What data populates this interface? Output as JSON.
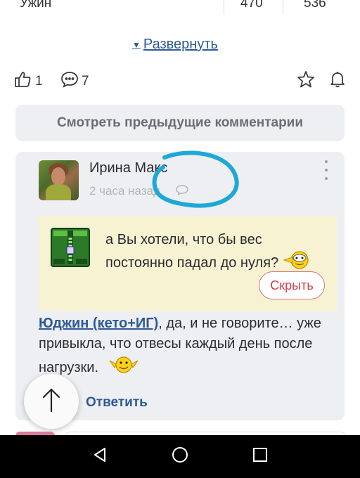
{
  "table_remnant": {
    "label": "Ужин",
    "v1": "470",
    "v2": "536"
  },
  "expand": {
    "label": "Развернуть"
  },
  "actions": {
    "likes": "1",
    "comments": "7"
  },
  "prev_comments": {
    "label": "Смотреть предыдущие комментарии"
  },
  "comment": {
    "author": "Ирина Макс",
    "time": "2 часа назад",
    "quote": "а Вы хотели, что бы вес постоянно падал до нуля?",
    "hide_label": "Скрыть",
    "mention": "Юджин (кето+ИГ)",
    "text": ", да, и не говорите… уже привыкла, что отвесы каждый день после нагрузки.",
    "reply_label": "Ответить"
  },
  "colors": {
    "accent": "#2d5a96",
    "card_bg": "#eeeff2",
    "quote_bg": "#f7f3d2",
    "hide_red": "#d43d4c",
    "annotation": "#1ea8d8"
  },
  "icons": [
    "thumbs-up-icon",
    "comment-icon",
    "star-icon",
    "bell-icon",
    "kebab-menu-icon",
    "reply-bubble-icon",
    "archive-icon",
    "smiley-icon",
    "arrow-up-icon",
    "nav-back-icon",
    "nav-home-icon",
    "nav-recents-icon"
  ]
}
